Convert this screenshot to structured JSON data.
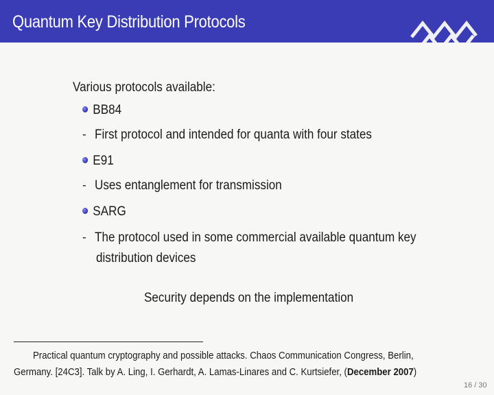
{
  "header": {
    "title": "Quantum Key Distribution Protocols",
    "color": "#3a3cb6"
  },
  "content": {
    "intro": "Various protocols available:",
    "protocols": [
      {
        "name": "BB84",
        "description": "First protocol and intended for quanta with four states"
      },
      {
        "name": "E91",
        "description": "Uses entanglement for transmission"
      },
      {
        "name": "SARG",
        "description_line1": "The protocol used in some commercial available quantum key",
        "description_line2": "distribution devices"
      }
    ],
    "security_note": "Security depends on the implementation"
  },
  "footnote": {
    "line1": "Practical quantum cryptography and possible attacks. Chaos Communication Congress, Berlin,",
    "line2_prefix": "Germany. [24C3]. Talk by A. Ling, I. Gerhardt, A. Lamas-Linares and C. Kurtsiefer, (",
    "line2_bold": "December 2007",
    "line2_suffix": ")"
  },
  "page_number": "16 / 30",
  "icons": {
    "logo": "university-logo",
    "bullet": "bullet-icon"
  }
}
